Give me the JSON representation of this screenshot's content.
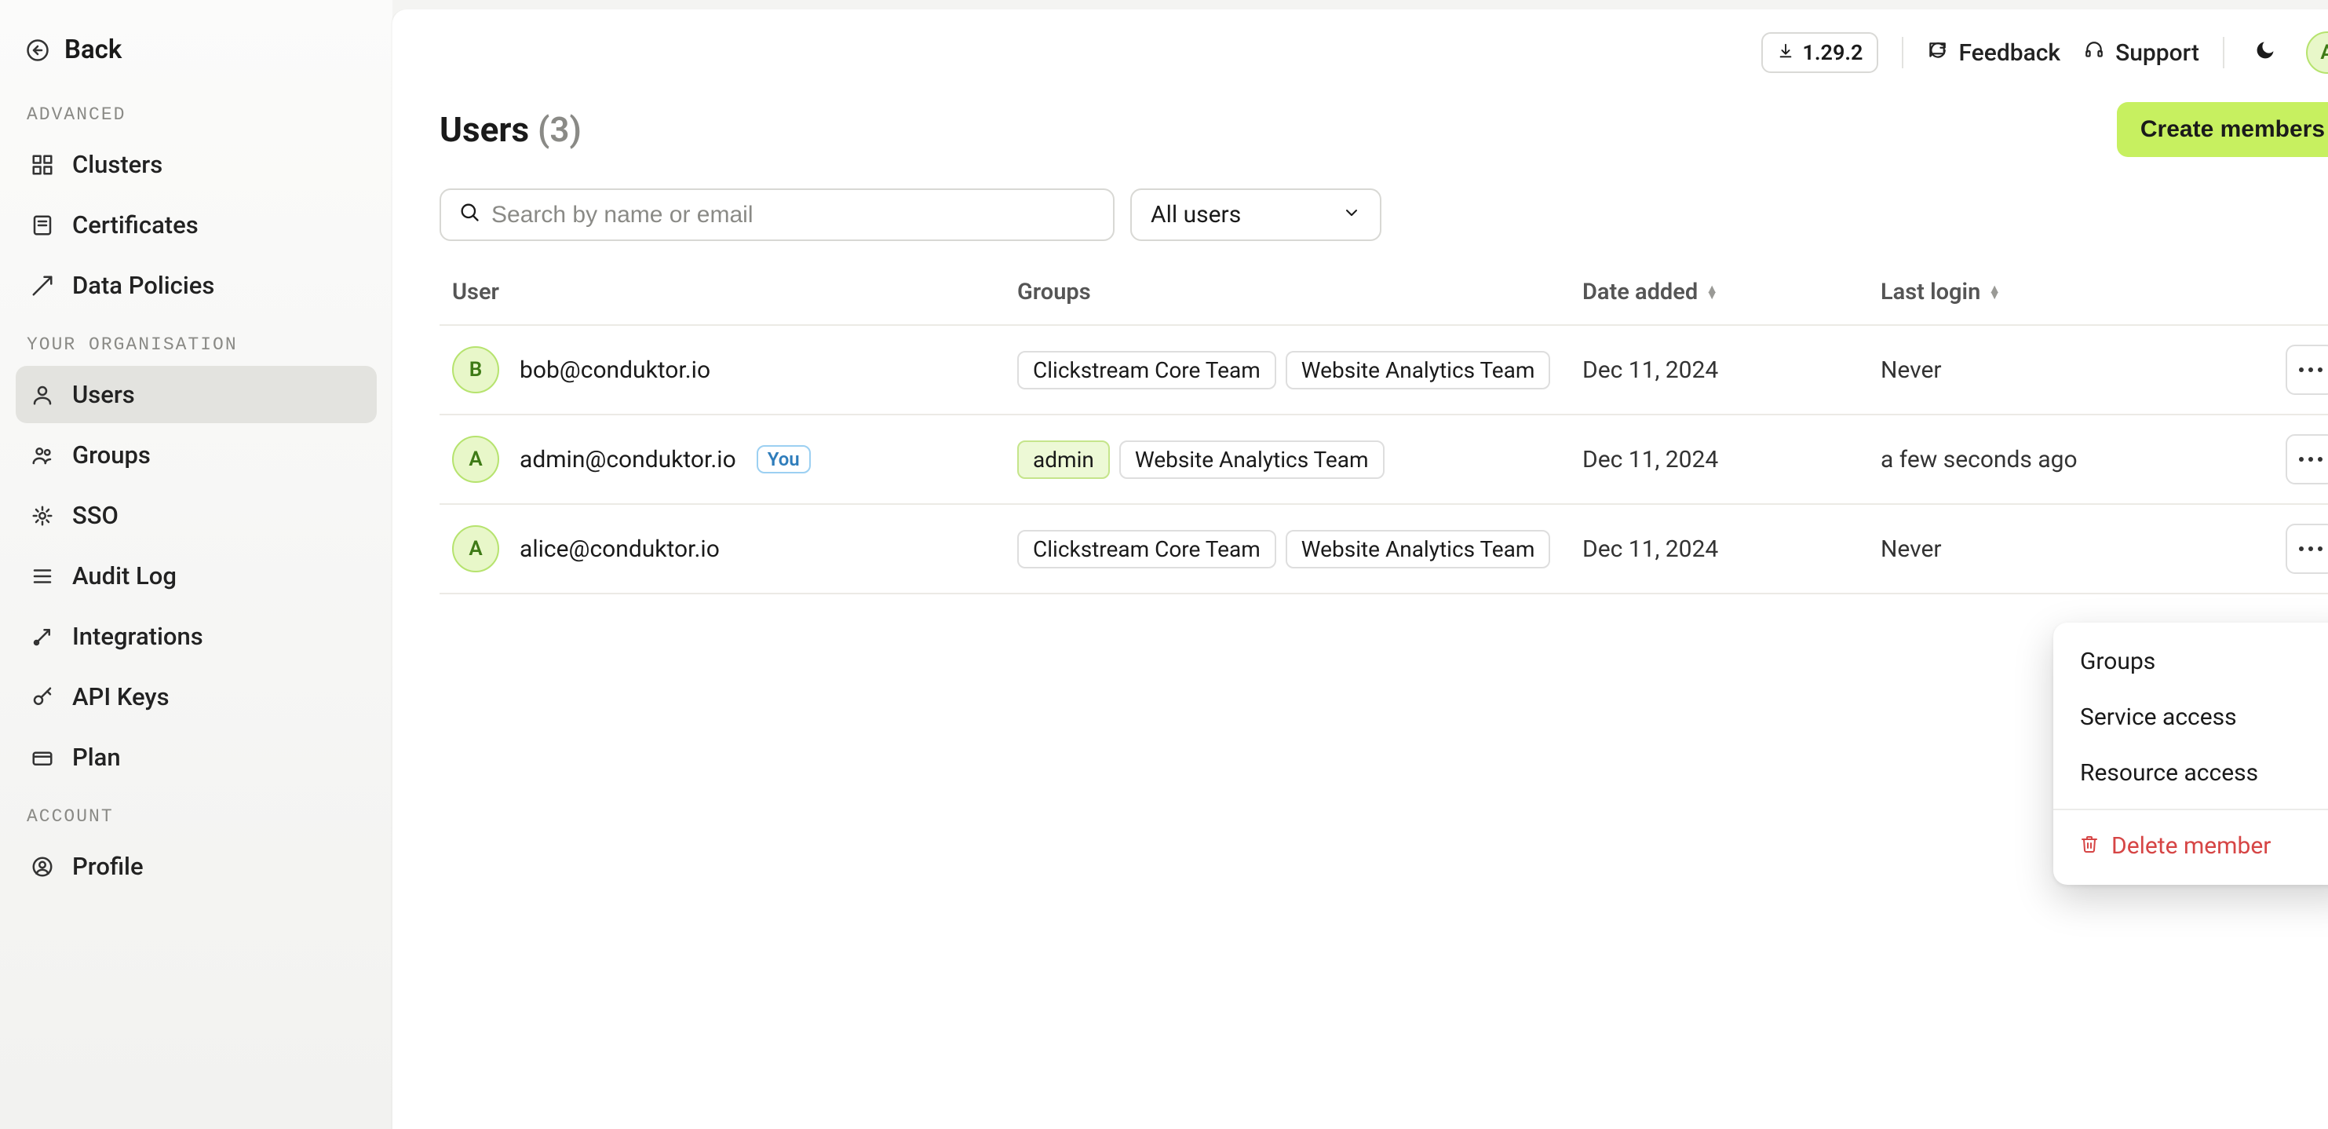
{
  "sidebar": {
    "back_label": "Back",
    "sections": {
      "advanced": {
        "label": "ADVANCED",
        "items": [
          {
            "id": "clusters",
            "label": "Clusters"
          },
          {
            "id": "certificates",
            "label": "Certificates"
          },
          {
            "id": "datapolicies",
            "label": "Data Policies"
          }
        ]
      },
      "org": {
        "label": "YOUR ORGANISATION",
        "items": [
          {
            "id": "users",
            "label": "Users"
          },
          {
            "id": "groups",
            "label": "Groups"
          },
          {
            "id": "sso",
            "label": "SSO"
          },
          {
            "id": "auditlog",
            "label": "Audit Log"
          },
          {
            "id": "integrations",
            "label": "Integrations"
          },
          {
            "id": "apikeys",
            "label": "API Keys"
          },
          {
            "id": "plan",
            "label": "Plan"
          }
        ]
      },
      "account": {
        "label": "ACCOUNT",
        "items": [
          {
            "id": "profile",
            "label": "Profile"
          }
        ]
      }
    }
  },
  "topbar": {
    "version": "1.29.2",
    "feedback_label": "Feedback",
    "support_label": "Support",
    "avatar_initial": "A"
  },
  "page": {
    "title": "Users",
    "count_display": "(3)",
    "create_label": "Create members"
  },
  "filters": {
    "search_placeholder": "Search by name or email",
    "select_value": "All users"
  },
  "table": {
    "columns": {
      "user": "User",
      "groups": "Groups",
      "date_added": "Date added",
      "last_login": "Last login"
    },
    "rows": [
      {
        "avatar_initial": "B",
        "email": "bob@conduktor.io",
        "is_you": false,
        "groups": [
          "Clickstream Core Team",
          "Website Analytics Team"
        ],
        "date_added": "Dec 11, 2024",
        "last_login": "Never"
      },
      {
        "avatar_initial": "A",
        "email": "admin@conduktor.io",
        "is_you": true,
        "you_label": "You",
        "groups": [
          "admin",
          "Website Analytics Team"
        ],
        "date_added": "Dec 11, 2024",
        "last_login": "a few seconds ago"
      },
      {
        "avatar_initial": "A",
        "email": "alice@conduktor.io",
        "is_you": false,
        "groups": [
          "Clickstream Core Team",
          "Website Analytics Team"
        ],
        "date_added": "Dec 11, 2024",
        "last_login": "Never"
      }
    ]
  },
  "context_menu": {
    "items": [
      {
        "label": "Groups"
      },
      {
        "label": "Service access"
      },
      {
        "label": "Resource access"
      }
    ],
    "delete_label": "Delete member"
  }
}
